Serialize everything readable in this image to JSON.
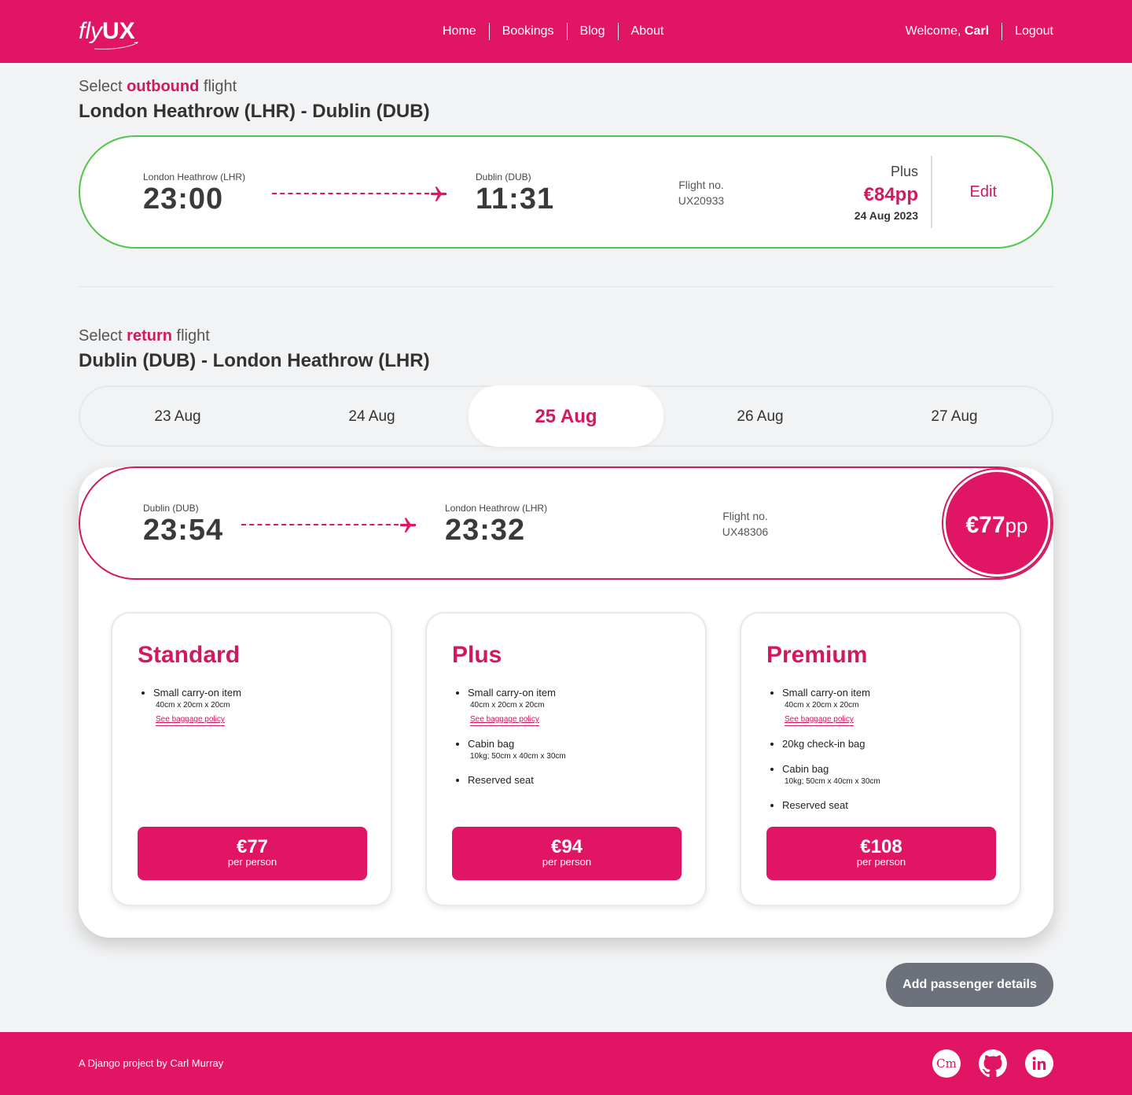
{
  "header": {
    "logo": {
      "fly": "fly",
      "ux": "UX"
    },
    "nav": [
      "Home",
      "Bookings",
      "Blog",
      "About"
    ],
    "welcome_prefix": "Welcome, ",
    "user_name": "Carl",
    "logout": "Logout"
  },
  "outbound": {
    "sub_prefix": "Select ",
    "sub_em": "outbound",
    "sub_suffix": " flight",
    "route": "London Heathrow (LHR) - Dublin (DUB)",
    "from_airport": "London Heathrow (LHR)",
    "dep_time": "23:00",
    "to_airport": "Dublin (DUB)",
    "arr_time": "11:31",
    "flight_no_label": "Flight no.",
    "flight_no": "UX20933",
    "fare_class": "Plus",
    "price": "€84pp",
    "date": "24 Aug 2023",
    "edit": "Edit"
  },
  "return": {
    "sub_prefix": "Select ",
    "sub_em": "return",
    "sub_suffix": " flight",
    "route": "Dublin (DUB) - London Heathrow (LHR)",
    "dates": [
      "23 Aug",
      "24 Aug",
      "25 Aug",
      "26 Aug",
      "27 Aug"
    ],
    "active_date_index": 2,
    "from_airport": "Dublin (DUB)",
    "dep_time": "23:54",
    "to_airport": "London Heathrow (LHR)",
    "arr_time": "23:32",
    "flight_no_label": "Flight no.",
    "flight_no": "UX48306",
    "price_amount": "€77",
    "price_suffix": "pp"
  },
  "tiers": [
    {
      "name": "Standard",
      "items": [
        {
          "label": "Small carry-on item",
          "detail": "40cm x 20cm x 20cm",
          "link": "See baggage policy"
        }
      ],
      "price": "€77",
      "per": "per person"
    },
    {
      "name": "Plus",
      "items": [
        {
          "label": "Small carry-on item",
          "detail": "40cm x 20cm x 20cm",
          "link": "See baggage policy"
        },
        {
          "label": "Cabin bag",
          "detail": "10kg; 50cm x 40cm x 30cm"
        },
        {
          "label": "Reserved seat"
        }
      ],
      "price": "€94",
      "per": "per person"
    },
    {
      "name": "Premium",
      "items": [
        {
          "label": "Small carry-on item",
          "detail": "40cm x 20cm x 20cm",
          "link": "See baggage policy"
        },
        {
          "label": "20kg check-in bag"
        },
        {
          "label": "Cabin bag",
          "detail": "10kg; 50cm x 40cm x 30cm"
        },
        {
          "label": "Reserved seat"
        }
      ],
      "price": "€108",
      "per": "per person"
    }
  ],
  "actions": {
    "add_passenger": "Add passenger details"
  },
  "footer": {
    "credit_prefix": "A Django project by ",
    "credit_name": "Carl Murray",
    "cm_icon_text": "Cm",
    "icons": [
      "cm-icon",
      "github-icon",
      "linkedin-icon"
    ]
  },
  "colors": {
    "brand": "#e01563",
    "selected_outline": "#52c44a",
    "button_muted": "#6c717c"
  }
}
